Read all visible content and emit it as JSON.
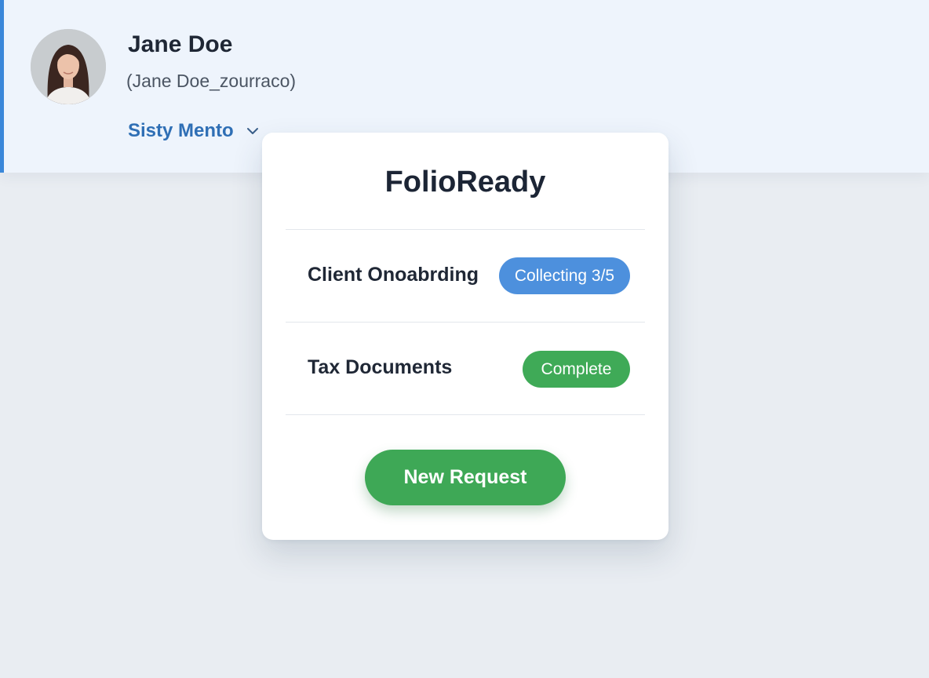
{
  "profile": {
    "name": "Jane Doe",
    "handle": "(Jane Doe_zourraco)",
    "account_label": "Sisty Mento",
    "avatar_icon": "person-photo"
  },
  "card": {
    "title": "FolioReady",
    "rows": [
      {
        "label": "Client Onoabrding",
        "status": "Collecting 3/5",
        "status_color": "#4d90dd"
      },
      {
        "label": "Tax Documents",
        "status": "Complete",
        "status_color": "#3faa57"
      }
    ],
    "primary_button": "New Request",
    "primary_color": "#3ea856"
  },
  "theme": {
    "accent": "#3a87d9",
    "header_bg": "#eef4fc",
    "page_bg": "#e9edf2"
  }
}
